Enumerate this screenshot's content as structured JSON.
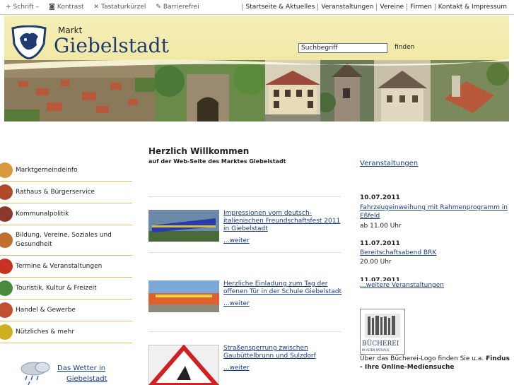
{
  "utility": {
    "left": [
      {
        "icon": "plus-icon",
        "label": "Schrift"
      },
      {
        "icon": "contrast-icon",
        "label": "Kontrast"
      },
      {
        "icon": "keyboard-icon",
        "label": "Tastaturkürzel"
      },
      {
        "icon": "accessibility-icon",
        "label": "Barrierefrei"
      }
    ],
    "font_minus": "–",
    "right": [
      "Startseite & Aktuelles",
      "Veranstaltungen",
      "Vereine",
      "Firmen",
      "Kontakt & Impressum"
    ]
  },
  "logo": {
    "markt": "Markt",
    "name": "Giebelstadt"
  },
  "search": {
    "value": "Suchbegriff",
    "button": "finden"
  },
  "sidebar": {
    "items": [
      {
        "label": "Marktgemeindeinfo",
        "color": "#d89a3a"
      },
      {
        "label": "Rathaus & Bürgerservice",
        "color": "#b04a2a"
      },
      {
        "label": "Kommunalpolitik",
        "color": "#8a3a2a"
      },
      {
        "label": "Bildung, Vereine, Soziales und Gesundheit",
        "color": "#c07030"
      },
      {
        "label": "Termine & Veranstaltungen",
        "color": "#c83020"
      },
      {
        "label": "Touristik, Kultur & Freizeit",
        "color": "#4a8a3a"
      },
      {
        "label": "Handel & Gewerbe",
        "color": "#c05030"
      },
      {
        "label": "Nützliches & mehr",
        "color": "#d0b020"
      }
    ],
    "weather": [
      "Das Wetter in",
      "Giebelstadt"
    ]
  },
  "main": {
    "title": "Herzlich Willkommen",
    "subtitle": "auf der Web-Seite des Marktes Giebelstadt",
    "news": [
      {
        "title": "Impressionen vom deutsch-italienischen Freundschaftsfest 2011 in Giebelstadt",
        "more": "...weiter"
      },
      {
        "title": "Herzliche Einladung zum Tag der offenen Tür in der Schule Giebelstadt",
        "more": "...weiter"
      },
      {
        "title": "Straßensperrung zwischen Gaubüttelbrunn und Sulzdorf",
        "more": "...weiter"
      }
    ]
  },
  "events": {
    "heading": "Veranstaltungen",
    "items": [
      {
        "date": "10.07.2011",
        "title": "Fahrzeugeinweihung mit Rahmenprogramm in Eßfeld",
        "time": "ab 11.00 Uhr"
      },
      {
        "date": "11.07.2011",
        "title": "Bereitschaftsabend BRK",
        "time": "20.00 Uhr"
      },
      {
        "date": "11.07.2011"
      }
    ],
    "more": "...weitere Veranstaltungen"
  },
  "library": {
    "logo_title": "BÜCHEREI",
    "logo_sub": "IM ALTEN RATHAUS",
    "text_plain": "Über das Bücherei-Logo finden Sie u.a. ",
    "text_bold": "Findus - Ihre Online-Mediensuche"
  }
}
